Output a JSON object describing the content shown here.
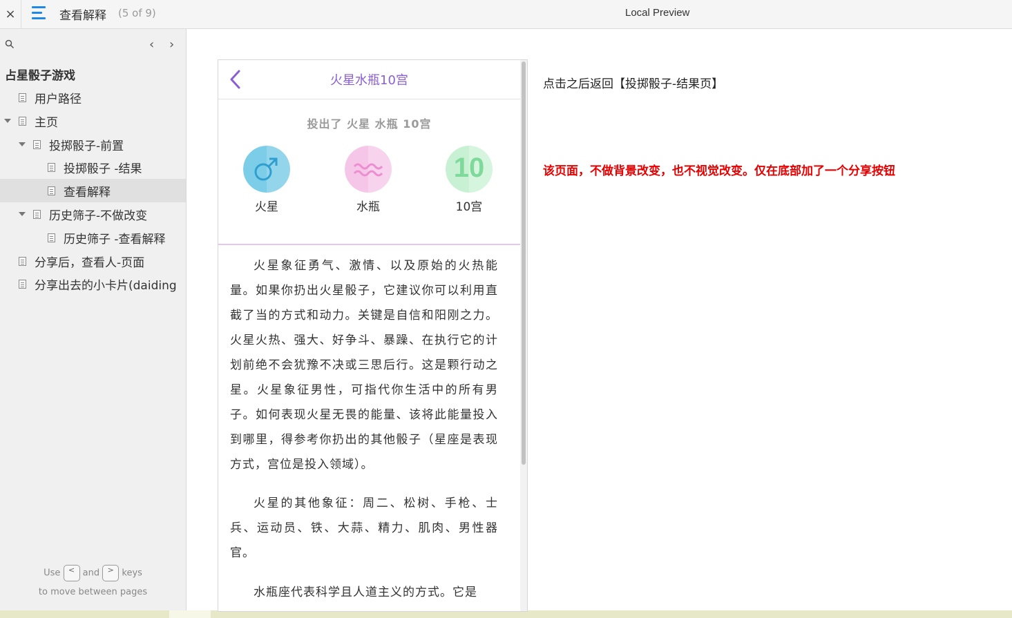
{
  "topbar": {
    "close_glyph": "×",
    "page_title": "查看解释",
    "page_counter": "(5 of 9)",
    "preview_title": "Local Preview"
  },
  "sidebar": {
    "prev_glyph": "‹",
    "next_glyph": "›",
    "tree_title": "占星骰子游戏",
    "items": [
      {
        "label": "用户路径"
      },
      {
        "label": "主页"
      },
      {
        "label": "投掷骰子-前置"
      },
      {
        "label": "投掷骰子 -结果"
      },
      {
        "label": "查看解释",
        "selected": true
      },
      {
        "label": "历史筛子-不做改变"
      },
      {
        "label": "历史筛子 -查看解释"
      },
      {
        "label": "分享后，查看人-页面"
      },
      {
        "label": "分享出去的小卡片(daiding"
      }
    ],
    "hint": {
      "use": "Use",
      "key_prev": "<",
      "and": "and",
      "key_next": ">",
      "keys": "keys",
      "line2": "to move between pages"
    }
  },
  "phone": {
    "title": "火星水瓶10宫",
    "rolled_text": "投出了  火星  水瓶  10宫",
    "dice": [
      {
        "symbol": "mars-icon",
        "label": "火星",
        "color": "#7ccde8"
      },
      {
        "symbol": "aquarius-icon",
        "label": "水瓶",
        "color": "#f6c6e8"
      },
      {
        "symbol": "10",
        "label": "10宫",
        "color": "#c8f0d2"
      }
    ],
    "paragraphs": [
      "火星象征勇气、激情、以及原始的火热能量。如果你扔出火星骰子，它建议你可以利用直截了当的方式和动力。关键是自信和阳刚之力。火星火热、强大、好争斗、暴躁、在执行它的计划前绝不会犹豫不决或三思后行。这是颗行动之星。火星象征男性，可指代你生活中的所有男子。如何表现火星无畏的能量、该将此能量投入到哪里，得参考你扔出的其他骰子（星座是表现方式，宫位是投入领域）。",
      "火星的其他象征：周二、松树、手枪、士兵、运动员、铁、大蒜、精力、肌肉、男性器官。",
      "水瓶座代表科学且人道主义的方式。它是"
    ]
  },
  "annotations": {
    "note1": "点击之后返回【投掷骰子-结果页】",
    "note2": "该页面，不做背景改变，也不视觉改变。仅在底部加了一个分享按钮"
  },
  "colors": {
    "accent": "#1e88e5",
    "phone_title": "#8a5fd6",
    "note_red": "#e60000"
  }
}
